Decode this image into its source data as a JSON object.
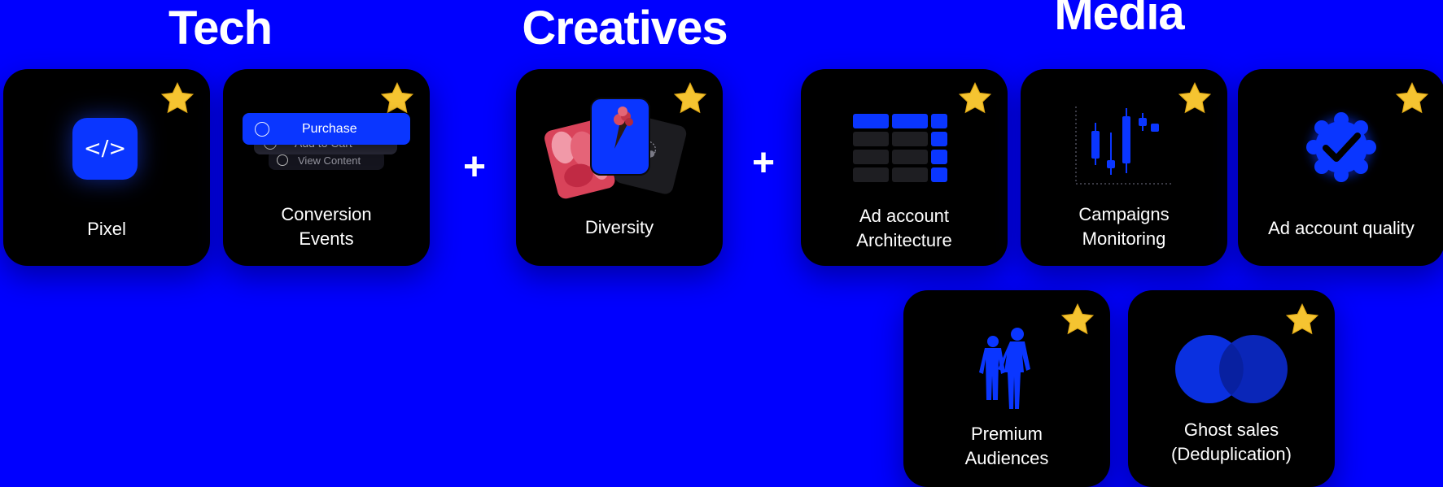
{
  "sections": {
    "tech": "Tech",
    "creatives": "Creatives",
    "media": "Media"
  },
  "plus_sign": "+",
  "cards": {
    "pixel": {
      "label": "Pixel",
      "icon": "code-icon"
    },
    "conversion_events": {
      "label": "Conversion\nEvents",
      "events": [
        "Purchase",
        "Add to Cart",
        "View Content"
      ]
    },
    "diversity": {
      "label": "Diversity",
      "icon": "images-stack-icon"
    },
    "ad_account_architecture": {
      "label": "Ad account\nArchitecture",
      "icon": "grid-table-icon"
    },
    "campaigns_monitoring": {
      "label": "Campaigns\nMonitoring",
      "icon": "candlestick-chart-icon"
    },
    "ad_account_quality": {
      "label": "Ad account quality",
      "icon": "verified-badge-icon"
    },
    "premium_audiences": {
      "label": "Premium\nAudiences",
      "icon": "people-silhouette-icon"
    },
    "ghost_sales": {
      "label": "Ghost sales\n(Deduplication)",
      "icon": "venn-diagram-icon"
    }
  },
  "colors": {
    "background": "#0000ff",
    "card": "#000000",
    "accent": "#0a36ff",
    "star": "#f5c431",
    "text": "#ffffff"
  }
}
